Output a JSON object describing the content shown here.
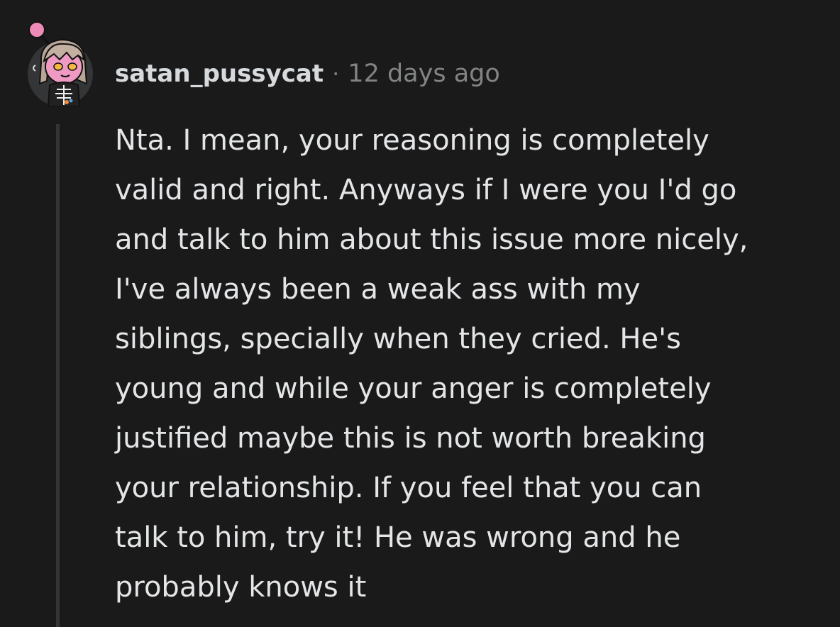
{
  "comment": {
    "author": "satan_pussycat",
    "separator": "·",
    "timestamp": "12 days ago",
    "avatar_icon": "snoo-avatar-icon",
    "body_lines": [
      "Nta. I mean, your reasoning is completely",
      "valid and right. Anyways if I were you I'd go",
      "and talk to him about this issue more nicely,",
      "I've always been a weak ass with my",
      "siblings, specially when they cried. He's",
      "young and while your anger is completely",
      "justified maybe this is not worth breaking",
      "your relationship. If you feel that you can",
      "talk to him, try it! He was wrong and he",
      "probably knows it"
    ]
  },
  "colors": {
    "background": "#1a1a1b",
    "text": "#d7dadc",
    "muted": "#818384",
    "thread_line": "#343536",
    "avatar_bg": "#343536",
    "accent_pink": "#ec8bb6"
  }
}
